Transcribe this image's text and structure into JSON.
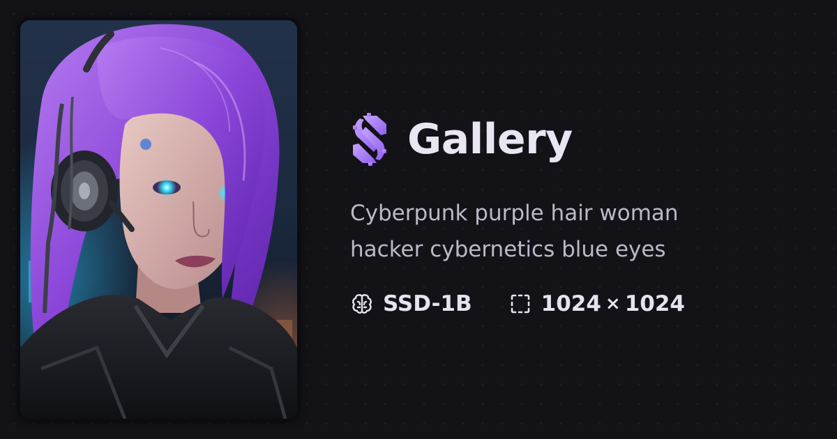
{
  "header": {
    "title": "Gallery",
    "logo_icon": "s-gear-logo-icon",
    "accent_color": "#a77ff0"
  },
  "image": {
    "subject": "generated-portrait-image"
  },
  "prompt": {
    "text": "Cyberpunk purple hair woman hacker cybernetics blue eyes"
  },
  "meta": {
    "model": {
      "icon": "brain-icon",
      "value": "SSD-1B"
    },
    "dimensions": {
      "icon": "dashed-frame-icon",
      "width": "1024",
      "separator": "×",
      "height": "1024"
    }
  },
  "colors": {
    "background": "#131217",
    "title": "#e9e6f2",
    "body_text": "#bdb9c7"
  }
}
